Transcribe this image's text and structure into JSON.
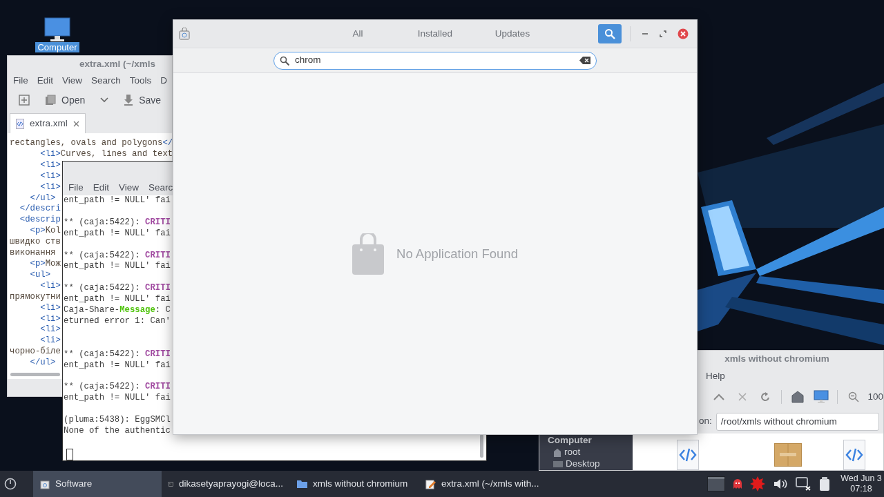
{
  "desktop": {
    "icons": [
      {
        "label": "Computer",
        "selected": true
      }
    ]
  },
  "editor": {
    "title": "extra.xml (~/xmls",
    "menu": [
      "File",
      "Edit",
      "View",
      "Search",
      "Tools",
      "D"
    ],
    "toolbar": [
      {
        "kind": "new"
      },
      {
        "kind": "open",
        "label": "Open"
      },
      {
        "kind": "dropdown"
      },
      {
        "kind": "save",
        "label": "Save"
      }
    ],
    "tabs": [
      {
        "label": "extra.xml",
        "selected": true
      }
    ],
    "lines": [
      {
        "parts": [
          {
            "text": "rectangles, ovals and polygons",
            "kind": "text"
          },
          {
            "text": "</",
            "kind": "tag"
          }
        ]
      },
      {
        "parts": [
          {
            "text": "      <li>",
            "kind": "tag"
          },
          {
            "text": "Curves, lines and text",
            "kind": "text"
          }
        ]
      },
      {
        "parts": [
          {
            "text": "      <li>",
            "kind": "tag"
          }
        ]
      },
      {
        "parts": [
          {
            "text": "      <li>",
            "kind": "tag"
          }
        ]
      },
      {
        "parts": [
          {
            "text": "      <li>",
            "kind": "tag"
          }
        ]
      },
      {
        "parts": [
          {
            "text": "    </ul>",
            "kind": "tag"
          }
        ]
      },
      {
        "parts": [
          {
            "text": "  </descri",
            "kind": "tag"
          }
        ]
      },
      {
        "parts": [
          {
            "text": "  <descrip",
            "kind": "tag"
          }
        ]
      },
      {
        "parts": [
          {
            "text": "    <p>",
            "kind": "tag"
          },
          {
            "text": "Kol",
            "kind": "text"
          }
        ]
      },
      {
        "parts": [
          {
            "text": "швидко ств",
            "kind": "text"
          }
        ]
      },
      {
        "parts": [
          {
            "text": "виконання",
            "kind": "text"
          }
        ]
      },
      {
        "parts": [
          {
            "text": "    <p>",
            "kind": "tag"
          },
          {
            "text": "Мож",
            "kind": "text"
          }
        ]
      },
      {
        "parts": [
          {
            "text": "    <ul>",
            "kind": "tag"
          }
        ]
      },
      {
        "parts": [
          {
            "text": "      <li>",
            "kind": "tag"
          }
        ]
      },
      {
        "parts": [
          {
            "text": "прямокутни",
            "kind": "text"
          }
        ]
      },
      {
        "parts": [
          {
            "text": "      <li>",
            "kind": "tag"
          }
        ]
      },
      {
        "parts": [
          {
            "text": "      <li>",
            "kind": "tag"
          }
        ]
      },
      {
        "parts": [
          {
            "text": "      <li>",
            "kind": "tag"
          }
        ]
      },
      {
        "parts": [
          {
            "text": "      <li>",
            "kind": "tag"
          }
        ]
      },
      {
        "parts": [
          {
            "text": "чорно-біле",
            "kind": "text"
          }
        ]
      },
      {
        "parts": [
          {
            "text": "    </ul>",
            "kind": "tag"
          }
        ]
      }
    ]
  },
  "terminal": {
    "menu": [
      "File",
      "Edit",
      "View",
      "Searc"
    ],
    "lines": [
      {
        "kind": "text",
        "parts": [
          {
            "text": "ent_path != NULL' fai"
          }
        ]
      },
      {
        "kind": "blank"
      },
      {
        "kind": "text",
        "parts": [
          {
            "text": "** (caja:5422): "
          },
          {
            "text": "CRITI",
            "kind": "critical"
          }
        ]
      },
      {
        "kind": "text",
        "parts": [
          {
            "text": "ent_path != NULL' fai"
          }
        ]
      },
      {
        "kind": "blank"
      },
      {
        "kind": "text",
        "parts": [
          {
            "text": "** (caja:5422): "
          },
          {
            "text": "CRITI",
            "kind": "critical"
          }
        ]
      },
      {
        "kind": "text",
        "parts": [
          {
            "text": "ent_path != NULL' fai"
          }
        ]
      },
      {
        "kind": "blank"
      },
      {
        "kind": "text",
        "parts": [
          {
            "text": "** (caja:5422): "
          },
          {
            "text": "CRITI",
            "kind": "critical"
          }
        ]
      },
      {
        "kind": "text",
        "parts": [
          {
            "text": "ent_path != NULL' fai"
          }
        ]
      },
      {
        "kind": "text",
        "parts": [
          {
            "text": "Caja-Share-"
          },
          {
            "text": "Message",
            "kind": "message"
          },
          {
            "text": ": C"
          }
        ]
      },
      {
        "kind": "text",
        "parts": [
          {
            "text": "eturned error 1: Can'"
          }
        ]
      },
      {
        "kind": "blank"
      },
      {
        "kind": "blank"
      },
      {
        "kind": "text",
        "parts": [
          {
            "text": "** (caja:5422): "
          },
          {
            "text": "CRITI",
            "kind": "critical"
          }
        ]
      },
      {
        "kind": "text",
        "parts": [
          {
            "text": "ent_path != NULL' fai"
          }
        ]
      },
      {
        "kind": "blank"
      },
      {
        "kind": "text",
        "parts": [
          {
            "text": "** (caja:5422): "
          },
          {
            "text": "CRITI",
            "kind": "critical"
          }
        ]
      },
      {
        "kind": "text",
        "parts": [
          {
            "text": "ent_path != NULL' fai"
          }
        ]
      },
      {
        "kind": "blank"
      },
      {
        "kind": "text",
        "parts": [
          {
            "text": "(pluma:5438): EggSMCl"
          }
        ]
      },
      {
        "kind": "text",
        "parts": [
          {
            "text": "None of the authentic"
          }
        ]
      }
    ]
  },
  "file_manager": {
    "title": "xmls without chromium",
    "menu": [
      "Help"
    ],
    "toolbar": [
      {
        "kind": "up"
      },
      {
        "kind": "stop"
      },
      {
        "kind": "reload"
      },
      {
        "kind": "separator"
      },
      {
        "kind": "home"
      },
      {
        "kind": "computer"
      },
      {
        "kind": "separator"
      },
      {
        "kind": "zoom-out"
      }
    ],
    "zoom": "100",
    "location_label": "on:",
    "location": "/root/xmls without chromium",
    "sidebar": {
      "heading": "Computer",
      "items": [
        {
          "label": "root",
          "kind": "home"
        },
        {
          "label": "Desktop",
          "kind": "desktop"
        }
      ]
    },
    "files": [
      {
        "kind": "xml"
      },
      {
        "kind": "archive"
      },
      {
        "kind": "xml"
      }
    ]
  },
  "software": {
    "tabs": [
      {
        "label": "All",
        "selected": false
      },
      {
        "label": "Installed",
        "selected": false
      },
      {
        "label": "Updates",
        "selected": false
      }
    ],
    "search_toggle": {
      "on": true
    },
    "search": {
      "value": "chrom"
    },
    "empty_state": {
      "message": "No Application Found"
    }
  },
  "taskbar": {
    "items": [
      {
        "label": "Software",
        "kind": "software",
        "selected": true
      },
      {
        "label": "dikasetyaprayogi@loca...",
        "kind": "terminal",
        "selected": false
      },
      {
        "label": "xmls without chromium",
        "kind": "folder",
        "selected": false
      },
      {
        "label": "extra.xml (~/xmls with...",
        "kind": "editor",
        "selected": false
      }
    ],
    "tray": [
      {
        "kind": "windows"
      },
      {
        "kind": "ghost"
      },
      {
        "kind": "burst"
      },
      {
        "kind": "volume"
      },
      {
        "kind": "network-off"
      },
      {
        "kind": "clipboard"
      }
    ],
    "clock": {
      "date": "Wed Jun 3",
      "time": "07:18"
    }
  }
}
